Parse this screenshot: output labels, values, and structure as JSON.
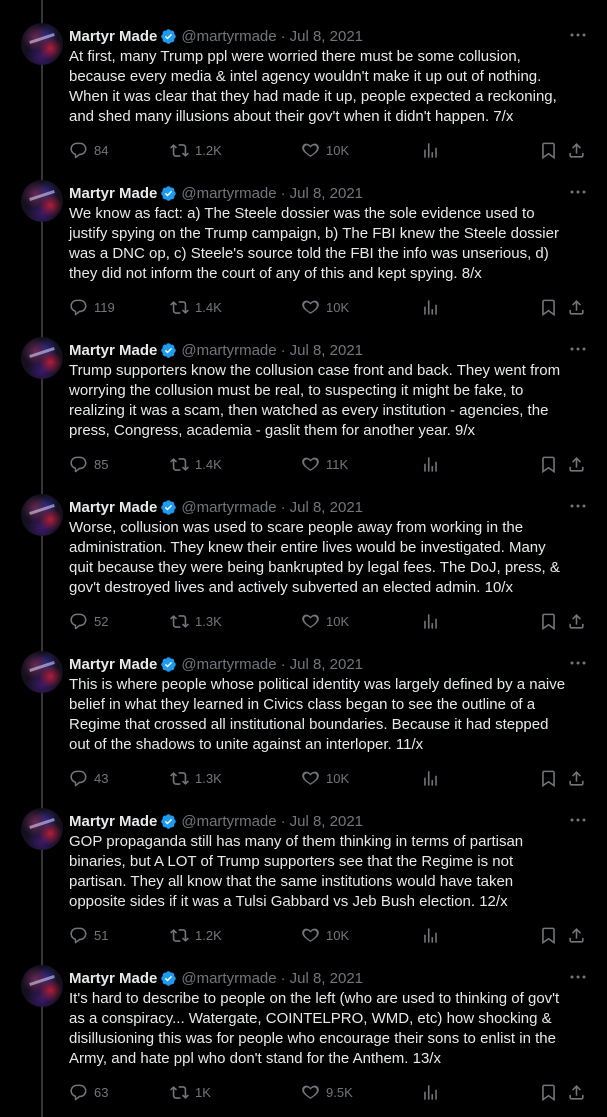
{
  "author": {
    "name": "Martyr Made",
    "handle": "@martyrmade",
    "separator": "·",
    "verified_color": "#1d9bf0"
  },
  "icons": [
    "reply-icon",
    "retweet-icon",
    "like-icon",
    "views-icon",
    "bookmark-icon",
    "share-icon",
    "more-icon",
    "verified-icon"
  ],
  "tweets": [
    {
      "date": "Jul 8, 2021",
      "text": "At first, many Trump ppl were worried there must be some collusion,\nbecause every media & intel agency wouldn't make it up out of nothing.\nWhen it was clear that they had made it up, people expected a reckoning,\nand shed many illusions about their gov't when it didn't happen. 7/x",
      "replies": "84",
      "retweets": "1.2K",
      "likes": "10K"
    },
    {
      "date": "Jul 8, 2021",
      "text": "We know as fact: a) The Steele dossier was the sole evidence used to\njustify spying on the Trump campaign, b) The FBI knew the Steele dossier\nwas a DNC op, c) Steele's source told the FBI the info was unserious, d)\nthey did not inform the court of any of this and kept spying. 8/x",
      "replies": "119",
      "retweets": "1.4K",
      "likes": "10K"
    },
    {
      "date": "Jul 8, 2021",
      "text": "Trump supporters know the collusion case front and back. They went from\nworrying the collusion must be real, to suspecting it might be fake, to\nrealizing it was a scam, then watched as every institution - agencies, the\npress, Congress, academia - gaslit them for another year. 9/x",
      "replies": "85",
      "retweets": "1.4K",
      "likes": "11K"
    },
    {
      "date": "Jul 8, 2021",
      "text": "Worse, collusion was used to scare people away from working in the\nadministration. They knew their entire lives would be investigated. Many\nquit because they were being bankrupted by legal fees. The DoJ, press, &\ngov't destroyed lives and actively subverted an elected admin. 10/x",
      "replies": "52",
      "retweets": "1.3K",
      "likes": "10K"
    },
    {
      "date": "Jul 8, 2021",
      "text": "This is where people whose political identity was largely defined by a naive\nbelief in what they learned in Civics class began to see the outline of a\nRegime that crossed all institutional boundaries. Because it had stepped\nout of the shadows to unite against an interloper. 11/x",
      "replies": "43",
      "retweets": "1.3K",
      "likes": "10K"
    },
    {
      "date": "Jul 8, 2021",
      "text": "GOP propaganda still has many of them thinking in terms of partisan\nbinaries, but A LOT of Trump supporters see that the Regime is not\npartisan. They all know that the same institutions would have taken\nopposite sides if it was a Tulsi Gabbard vs Jeb Bush election. 12/x",
      "replies": "51",
      "retweets": "1.2K",
      "likes": "10K"
    },
    {
      "date": "Jul 8, 2021",
      "text": "It's hard to describe to people on the left (who are used to thinking of gov't\nas a conspiracy... Watergate, COINTELPRO, WMD, etc) how shocking &\ndisillusioning this was for people who encourage their sons to enlist in the\nArmy, and hate ppl who don't stand for the Anthem. 13/x",
      "replies": "63",
      "retweets": "1K",
      "likes": "9.5K"
    }
  ]
}
